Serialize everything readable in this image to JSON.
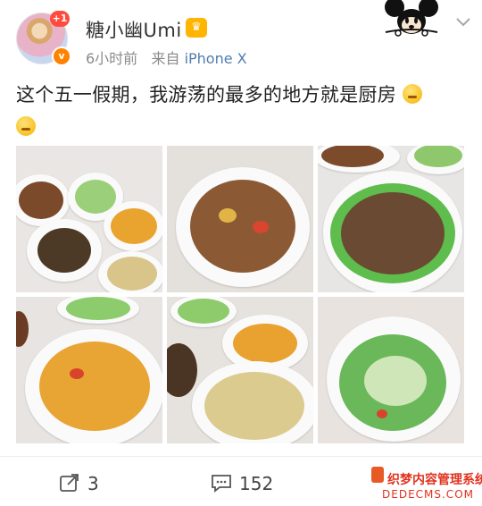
{
  "header": {
    "avatar_badge": "+1",
    "vip_badge": "v",
    "username": "糖小幽Umi",
    "crown_badge": "♛",
    "time": "6小时前",
    "source_prefix": "来自",
    "source": "iPhone X"
  },
  "post": {
    "text": "这个五一假期，我游荡的最多的地方就是厨房"
  },
  "images": [
    {
      "name": "photo-1"
    },
    {
      "name": "photo-2"
    },
    {
      "name": "photo-3"
    },
    {
      "name": "photo-4"
    },
    {
      "name": "photo-5"
    },
    {
      "name": "photo-6"
    }
  ],
  "actions": {
    "repost_count": "3",
    "comment_count": "152"
  },
  "watermark": {
    "line1": "织梦内容管理系统",
    "line2": "DEDECMS.COM"
  },
  "colors": {
    "link": "#507daf",
    "badge_red": "#ff4b3e",
    "vip_orange": "#ff8200"
  }
}
